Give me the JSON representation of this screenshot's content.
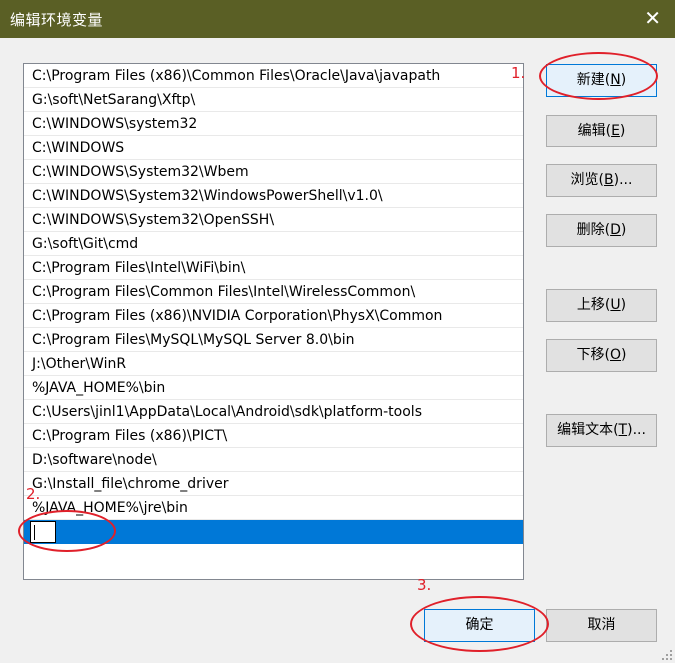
{
  "window": {
    "title": "编辑环境变量",
    "close_glyph": "✕"
  },
  "paths": [
    "C:\\Program Files (x86)\\Common Files\\Oracle\\Java\\javapath",
    "G:\\soft\\NetSarang\\Xftp\\",
    "C:\\WINDOWS\\system32",
    "C:\\WINDOWS",
    "C:\\WINDOWS\\System32\\Wbem",
    "C:\\WINDOWS\\System32\\WindowsPowerShell\\v1.0\\",
    "C:\\WINDOWS\\System32\\OpenSSH\\",
    "G:\\soft\\Git\\cmd",
    "C:\\Program Files\\Intel\\WiFi\\bin\\",
    "C:\\Program Files\\Common Files\\Intel\\WirelessCommon\\",
    "C:\\Program Files (x86)\\NVIDIA Corporation\\PhysX\\Common",
    "C:\\Program Files\\MySQL\\MySQL Server 8.0\\bin",
    "J:\\Other\\WinR",
    "%JAVA_HOME%\\bin",
    "C:\\Users\\jinl1\\AppData\\Local\\Android\\sdk\\platform-tools",
    "C:\\Program Files (x86)\\PICT\\",
    "D:\\software\\node\\",
    "G:\\Install_file\\chrome_driver",
    "%JAVA_HOME%\\jre\\bin"
  ],
  "new_entry_value": "",
  "buttons": {
    "new": {
      "label": "新建(",
      "key": "N",
      "end": ")"
    },
    "edit": {
      "label": "编辑(",
      "key": "E",
      "end": ")"
    },
    "browse": {
      "label": "浏览(",
      "key": "B",
      "end": ")..."
    },
    "delete": {
      "label": "删除(",
      "key": "D",
      "end": ")"
    },
    "up": {
      "label": "上移(",
      "key": "U",
      "end": ")"
    },
    "down": {
      "label": "下移(",
      "key": "O",
      "end": ")"
    },
    "edit_text": {
      "label": "编辑文本(",
      "key": "T",
      "end": ")..."
    },
    "ok": {
      "label": "确定"
    },
    "cancel": {
      "label": "取消"
    }
  },
  "annotations": {
    "step1": "1.",
    "step2": "2.",
    "step3": "3.",
    "color": "#e0202a"
  },
  "colors": {
    "titlebar": "#5a5f25",
    "selection": "#0078d7"
  }
}
